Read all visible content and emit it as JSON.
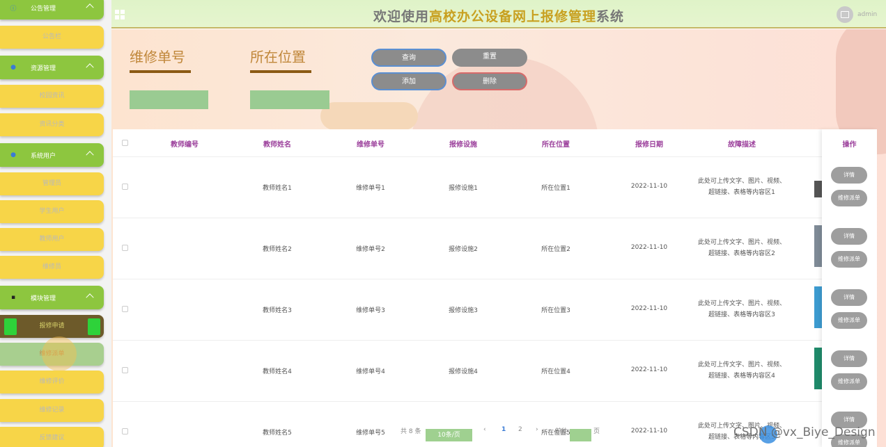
{
  "topbar": {
    "title_part1": "欢迎使用",
    "title_part2": "高校办公设备网上报修管理",
    "title_part3": "系统",
    "username": "admin"
  },
  "sidebar": {
    "groups": [
      {
        "label": "公告管理",
        "icon": "info-icon"
      },
      {
        "label": "资源管理",
        "icon": "drop-icon"
      },
      {
        "label": "系统用户",
        "icon": "user-icon"
      },
      {
        "label": "模块管理",
        "icon": "grid-icon"
      }
    ],
    "items": {
      "notice": "公告栏",
      "school_info": "校园资讯",
      "info_category": "资讯分类",
      "admin": "管理员",
      "student_user": "学生用户",
      "teacher_user": "教师用户",
      "repair_worker": "维修员",
      "repair_apply": "报修申请",
      "repair_dispatch": "维修派单",
      "repair_review": "维修评价",
      "repair_record": "维修记录",
      "feedback": "反馈建议"
    }
  },
  "search": {
    "field1_label": "维修单号",
    "field2_label": "所在位置",
    "buttons": {
      "query": "查询",
      "reset": "重置",
      "add": "添加",
      "delete": "删除"
    }
  },
  "table": {
    "headers": [
      "教师编号",
      "教师姓名",
      "维修单号",
      "报修设施",
      "所在位置",
      "报修日期",
      "故障描述",
      "操作"
    ],
    "rows": [
      {
        "teacher_name": "教师姓名1",
        "order_no": "维修单号1",
        "facility": "报修设施1",
        "location": "所在位置1",
        "date": "2022-11-10",
        "desc": "此处可上传文字、图片、视频、超链接、表格等内容区1"
      },
      {
        "teacher_name": "教师姓名2",
        "order_no": "维修单号2",
        "facility": "报修设施2",
        "location": "所在位置2",
        "date": "2022-11-10",
        "desc": "此处可上传文字、图片、视频、超链接、表格等内容区2"
      },
      {
        "teacher_name": "教师姓名3",
        "order_no": "维修单号3",
        "facility": "报修设施3",
        "location": "所在位置3",
        "date": "2022-11-10",
        "desc": "此处可上传文字、图片、视频、超链接、表格等内容区3"
      },
      {
        "teacher_name": "教师姓名4",
        "order_no": "维修单号4",
        "facility": "报修设施4",
        "location": "所在位置4",
        "date": "2022-11-10",
        "desc": "此处可上传文字、图片、视频、超链接、表格等内容区4"
      },
      {
        "teacher_name": "教师姓名5",
        "order_no": "维修单号5",
        "facility": "报修设施5",
        "location": "所在位置5",
        "date": "2022-11-10",
        "desc": "此处可上传文字、图片、视频、超链接、表格等内容区5"
      }
    ],
    "op_detail": "详情",
    "op_dispatch": "维修派单"
  },
  "pagination": {
    "total": "共 8 条",
    "page_size": "10条/页",
    "page1": "1",
    "page2": "2",
    "goto": "前往",
    "page_unit": "页"
  },
  "watermark": "CSDN @vx_Biye_Design"
}
